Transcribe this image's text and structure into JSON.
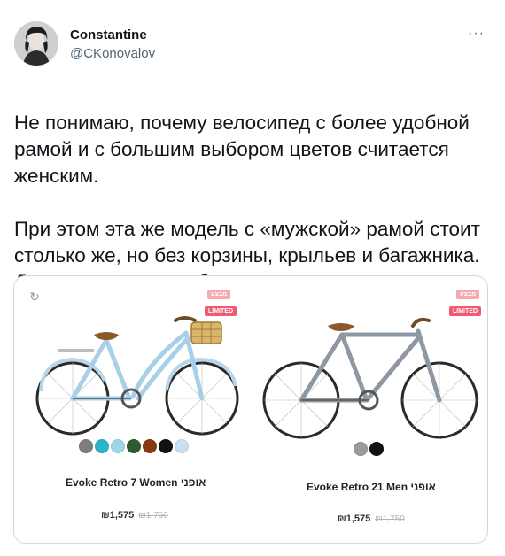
{
  "author": {
    "display_name": "Constantine",
    "handle": "@CKonovalov",
    "more_label": "···"
  },
  "tweet": {
    "paragraph_1": "Не понимаю, почему велосипед с более удобной рамой и с большим выбором цветов считается женским.",
    "paragraph_2": "При этом эта же модель с «мужской» рамой стоит столько же, но без корзины, крыльев и багажника. Да и со скудным выбором цветов."
  },
  "media": {
    "refresh_icon": "↻",
    "products": [
      {
        "sale_badge": "מבצע",
        "limited_badge": "LIMITED",
        "name": "Evoke Retro 7 Women אופני",
        "price_now": "₪1,575",
        "price_was": "₪1,750",
        "colors": [
          "#7d7d7d",
          "#2ab5c7",
          "#9fd6e6",
          "#2f5a2f",
          "#8a3a12",
          "#111111",
          "#c9dff2"
        ]
      },
      {
        "sale_badge": "מבצע",
        "limited_badge": "LIMITED",
        "name": "Evoke Retro 21 Men אופני",
        "price_now": "₪1,575",
        "price_was": "₪1,750",
        "colors": [
          "#9a9a9a",
          "#111111"
        ]
      }
    ]
  }
}
